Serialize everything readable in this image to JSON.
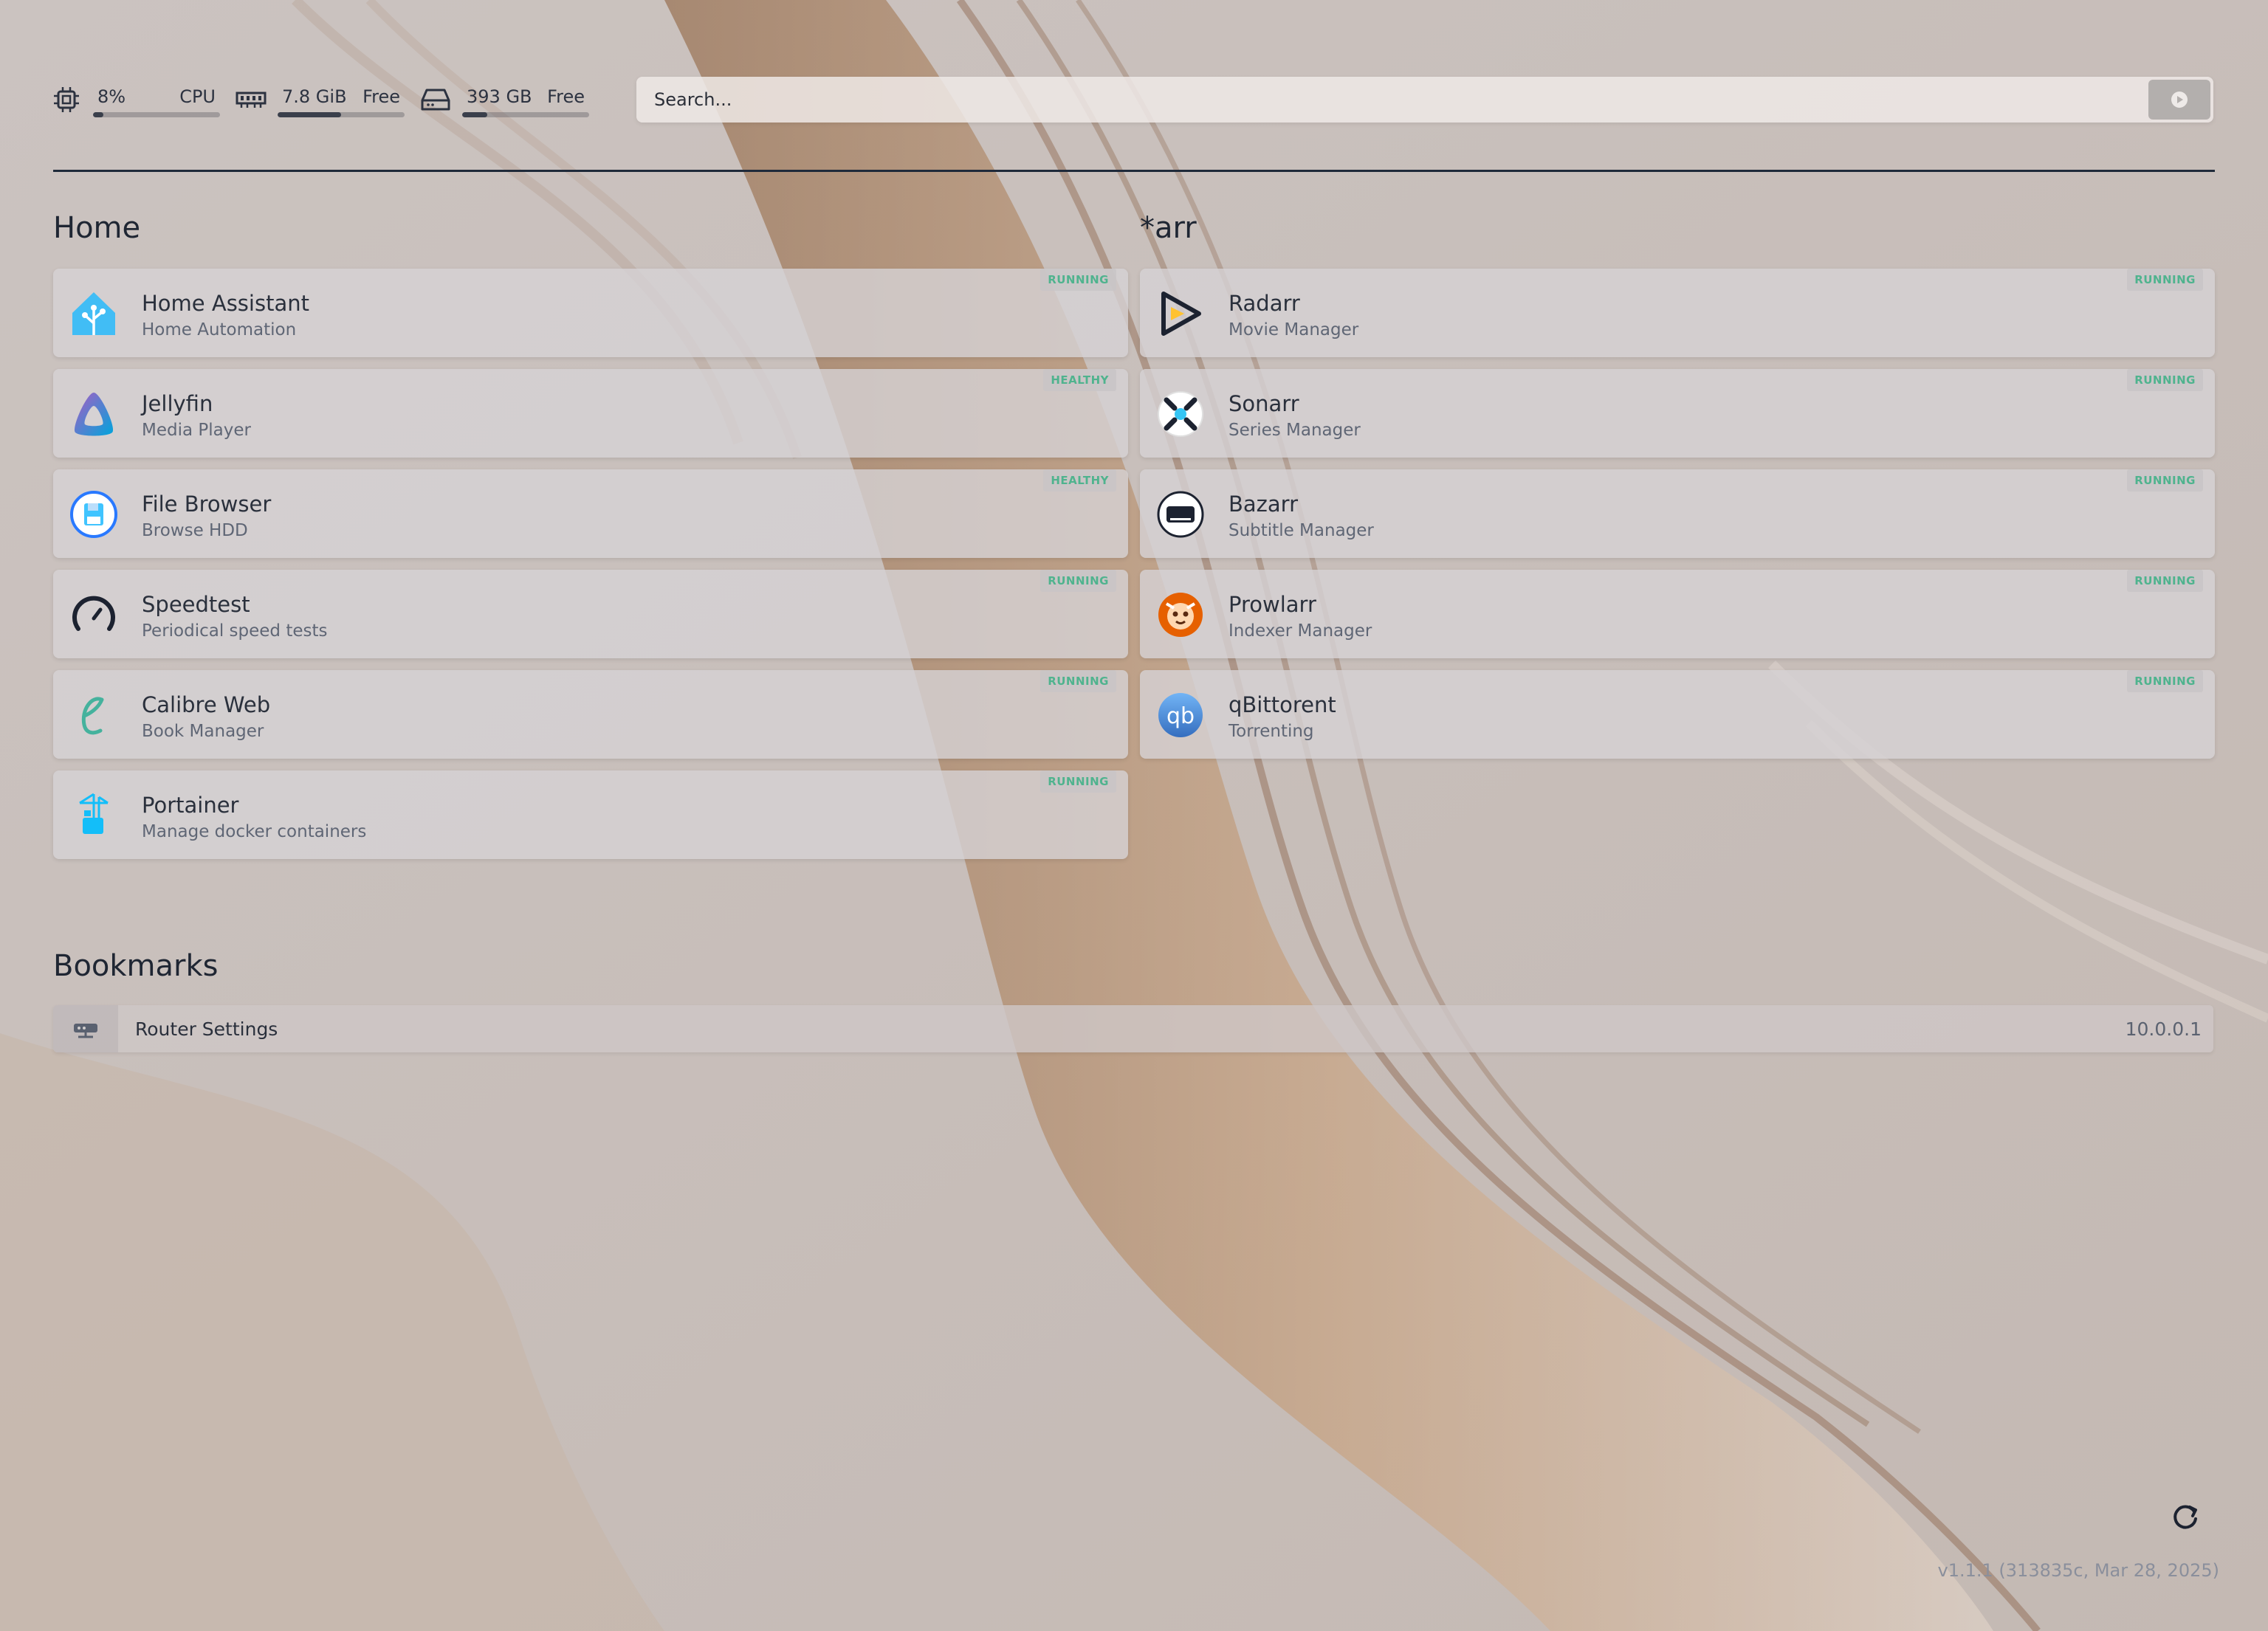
{
  "resources": {
    "cpu": {
      "value": "8%",
      "label": "CPU",
      "fraction": 0.08,
      "icon": "cpu-icon"
    },
    "memory": {
      "value": "7.8 GiB",
      "label": "Free",
      "fraction": 0.5,
      "icon": "memory-icon"
    },
    "disk": {
      "value": "393 GB",
      "label": "Free",
      "fraction": 0.2,
      "icon": "disk-icon"
    }
  },
  "search": {
    "placeholder": "Search...",
    "button_icon": "search-engine-icon"
  },
  "groups": {
    "home": {
      "title": "Home",
      "services": [
        {
          "name": "Home Assistant",
          "description": "Home Automation",
          "status": "RUNNING",
          "icon": "home-assistant-icon"
        },
        {
          "name": "Jellyfin",
          "description": "Media Player",
          "status": "HEALTHY",
          "icon": "jellyfin-icon"
        },
        {
          "name": "File Browser",
          "description": "Browse HDD",
          "status": "HEALTHY",
          "icon": "file-browser-icon"
        },
        {
          "name": "Speedtest",
          "description": "Periodical speed tests",
          "status": "RUNNING",
          "icon": "speedometer-icon"
        },
        {
          "name": "Calibre Web",
          "description": "Book Manager",
          "status": "RUNNING",
          "icon": "calibre-icon"
        },
        {
          "name": "Portainer",
          "description": "Manage docker containers",
          "status": "RUNNING",
          "icon": "portainer-icon"
        }
      ]
    },
    "arr": {
      "title": "*arr",
      "services": [
        {
          "name": "Radarr",
          "description": "Movie Manager",
          "status": "RUNNING",
          "icon": "radarr-icon"
        },
        {
          "name": "Sonarr",
          "description": "Series Manager",
          "status": "RUNNING",
          "icon": "sonarr-icon"
        },
        {
          "name": "Bazarr",
          "description": "Subtitle Manager",
          "status": "RUNNING",
          "icon": "bazarr-icon"
        },
        {
          "name": "Prowlarr",
          "description": "Indexer Manager",
          "status": "RUNNING",
          "icon": "prowlarr-icon"
        },
        {
          "name": "qBittorent",
          "description": "Torrenting",
          "status": "RUNNING",
          "icon": "qbittorrent-icon",
          "icon_text": "qb"
        }
      ]
    }
  },
  "bookmarks": {
    "title": "Bookmarks",
    "items": [
      {
        "name": "Router Settings",
        "url": "10.0.0.1",
        "icon": "router-icon"
      }
    ]
  },
  "footer": {
    "version": "v1.1.1 (313835c, Mar 28, 2025)",
    "refresh_icon": "refresh-icon"
  },
  "colors": {
    "status_running": "#4fb38e",
    "accent_dark": "#1f2a3a"
  }
}
